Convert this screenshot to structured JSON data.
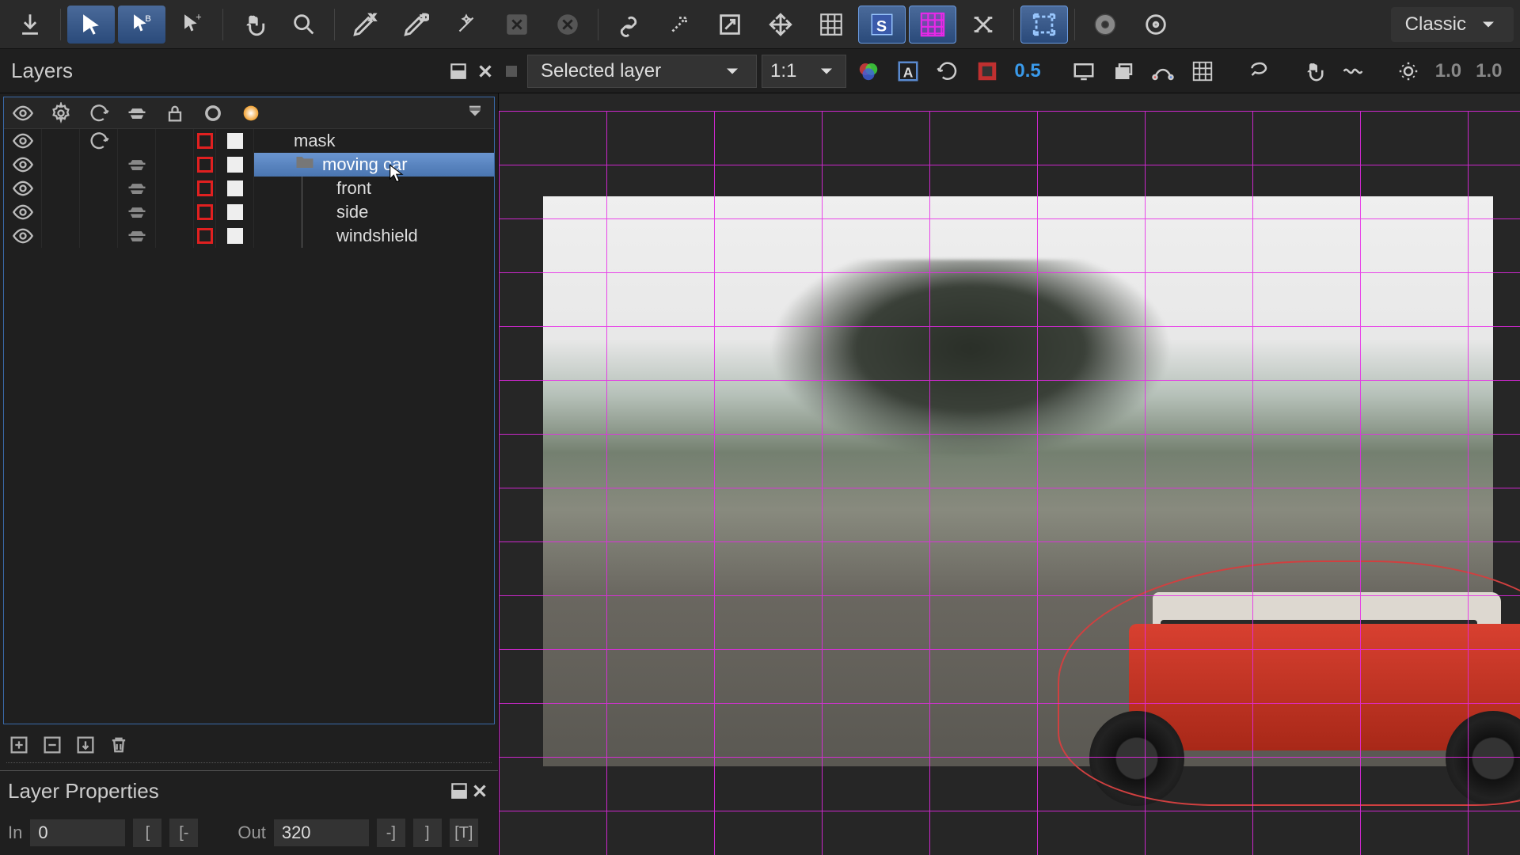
{
  "toolbar": {
    "theme_label": "Classic"
  },
  "secondary": {
    "layers_title": "Layers",
    "selected_layer_label": "Selected layer",
    "zoom_label": "1:1",
    "opacity1": "0.5",
    "opacity2": "1.0",
    "opacity3": "1.0"
  },
  "layers": {
    "items": [
      {
        "name": "mask"
      },
      {
        "name": "moving car"
      },
      {
        "name": "front"
      },
      {
        "name": "side"
      },
      {
        "name": "windshield"
      }
    ]
  },
  "properties": {
    "title": "Layer Properties",
    "in_label": "In",
    "in_value": "0",
    "out_label": "Out",
    "out_value": "320",
    "bracket1": "[",
    "bracket2": "[-",
    "bracket3": "-]",
    "bracket4": "]",
    "bracket5": "[T]"
  }
}
